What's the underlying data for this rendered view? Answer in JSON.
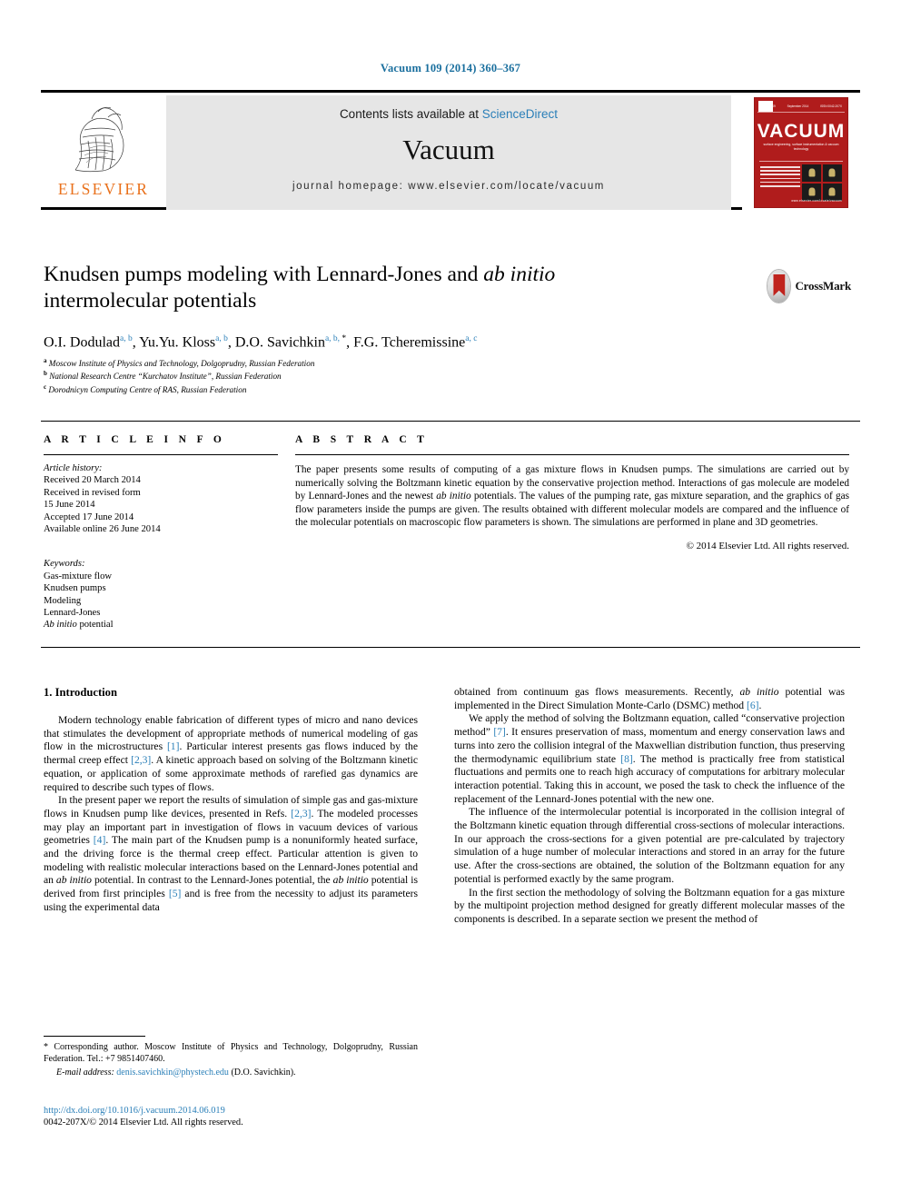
{
  "running_head": "Vacuum 109 (2014) 360–367",
  "masthead": {
    "publisher_name": "ELSEVIER",
    "contents_prefix": "Contents lists available at ",
    "contents_link": "ScienceDirect",
    "journal_title": "Vacuum",
    "homepage": "journal homepage: www.elsevier.com/locate/vacuum",
    "cover": {
      "name": "VACUUM",
      "tick_left": "Volume 109",
      "tick_mid": "September 2014",
      "tick_right": "ISSN 0042-207X",
      "subtitle": "surface engineering, surface instrumentation & vacuum technology",
      "sub2": "Incorporating: Vacuum solutions, surface engineering, thin films,\nsurface instrumentation and plasma applications\nTechnical and Environmental Aspects of Vacuum Science",
      "footer": "www.elsevier.com/locate/vacuum"
    }
  },
  "article": {
    "title_line1": "Knudsen pumps modeling with Lennard-Jones and ",
    "title_italic": "ab initio",
    "title_line2": "intermolecular potentials",
    "crossmark_label": "CrossMark",
    "authors": [
      {
        "name": "O.I. Dodulad",
        "marks": "a, b",
        "sep": ", "
      },
      {
        "name": "Yu.Yu. Kloss",
        "marks": "a, b",
        "sep": ", "
      },
      {
        "name": "D.O. Savichkin",
        "marks": "a, b, ",
        "star": "*",
        "sep": ", "
      },
      {
        "name": "F.G. Tcheremissine",
        "marks": "a, c",
        "sep": ""
      }
    ],
    "affiliations": [
      {
        "mark": "a",
        "text": "Moscow Institute of Physics and Technology, Dolgoprudny, Russian Federation"
      },
      {
        "mark": "b",
        "text": "National Research Centre “Kurchatov Institute”, Russian Federation"
      },
      {
        "mark": "c",
        "text": "Dorodnicyn Computing Centre of RAS, Russian Federation"
      }
    ]
  },
  "info": {
    "heading": "A R T I C L E   I N F O",
    "history_label": "Article history:",
    "history": [
      "Received 20 March 2014",
      "Received in revised form",
      "15 June 2014",
      "Accepted 17 June 2014",
      "Available online 26 June 2014"
    ],
    "keywords_label": "Keywords:",
    "keywords": [
      "Gas-mixture flow",
      "Knudsen pumps",
      "Modeling",
      "Lennard-Jones"
    ],
    "keyword_last_italic": "Ab initio",
    "keyword_last_rest": " potential"
  },
  "abstract": {
    "heading": "A B S T R A C T",
    "part1": "The paper presents some results of computing of a gas mixture flows in Knudsen pumps. The simulations are carried out by numerically solving the Boltzmann kinetic equation by the conservative projection method. Interactions of gas molecule are modeled by Lennard-Jones and the newest ",
    "italic1": "ab initio",
    "part2": " potentials. The values of the pumping rate, gas mixture separation, and the graphics of gas flow parameters inside the pumps are given. The results obtained with different molecular models are compared and the influence of the molecular potentials on macroscopic flow parameters is shown. The simulations are performed in plane and 3D geometries.",
    "copyright": "© 2014 Elsevier Ltd. All rights reserved."
  },
  "body": {
    "section_heading": "1. Introduction",
    "left": {
      "p1_a": "Modern technology enable fabrication of different types of micro and nano devices that stimulates the development of appropriate methods of numerical modeling of gas flow in the microstructures ",
      "p1_ref1": "[1]",
      "p1_b": ". Particular interest presents gas flows induced by the thermal creep effect ",
      "p1_ref2": "[2,3]",
      "p1_c": ". A kinetic approach based on solving of the Boltzmann kinetic equation, or application of some approximate methods of rarefied gas dynamics are required to describe such types of flows.",
      "p2_a": "In the present paper we report the results of simulation of simple gas and gas-mixture flows in Knudsen pump like devices, presented in Refs. ",
      "p2_ref1": "[2,3]",
      "p2_b": ". The modeled processes may play an important part in investigation of flows in vacuum devices of various geometries ",
      "p2_ref2": "[4]",
      "p2_c": ". The main part of the Knudsen pump is a nonuniformly heated surface, and the driving force is the thermal creep effect. Particular attention is given to modeling with realistic molecular interactions based on the Lennard-Jones potential and an ",
      "p2_it1": "ab initio",
      "p2_d": " potential. In contrast to the Lennard-Jones potential, the ",
      "p2_it2": "ab initio",
      "p2_e": " potential is derived from first principles ",
      "p2_ref3": "[5]",
      "p2_f": " and is free from the necessity to adjust its parameters using the experimental data"
    },
    "right": {
      "p1_a": "obtained from continuum gas flows measurements. Recently, ",
      "p1_it1": "ab initio",
      "p1_b": " potential was implemented in the Direct Simulation Monte-Carlo (DSMC) method ",
      "p1_ref1": "[6]",
      "p1_c": ".",
      "p2_a": "We apply the method of solving the Boltzmann equation, called “conservative projection method” ",
      "p2_ref1": "[7]",
      "p2_b": ". It ensures preservation of mass, momentum and energy conservation laws and turns into zero the collision integral of the Maxwellian distribution function, thus preserving the thermodynamic equilibrium state ",
      "p2_ref2": "[8]",
      "p2_c": ". The method is practically free from statistical fluctuations and permits one to reach high accuracy of computations for arbitrary molecular interaction potential. Taking this in account, we posed the task to check the influence of the replacement of the Lennard-Jones potential with the new one.",
      "p3": "The influence of the intermolecular potential is incorporated in the collision integral of the Boltzmann kinetic equation through differential cross-sections of molecular interactions. In our approach the cross-sections for a given potential are pre-calculated by trajectory simulation of a huge number of molecular interactions and stored in an array for the future use. After the cross-sections are obtained, the solution of the Boltzmann equation for any potential is performed exactly by the same program.",
      "p4": "In the first section the methodology of solving the Boltzmann equation for a gas mixture by the multipoint projection method designed for greatly different molecular masses of the components is described. In a separate section we present the method of"
    }
  },
  "footnotes": {
    "star": "*",
    "corresponding": " Corresponding author. Moscow Institute of Physics and Technology, Dolgoprudny, Russian Federation. Tel.: +7 9851407460.",
    "email_label": "E-mail address:",
    "email": "denis.savichkin@phystech.edu",
    "email_suffix": " (D.O. Savichkin)."
  },
  "doi_block": {
    "doi_url": "http://dx.doi.org/10.1016/j.vacuum.2014.06.019",
    "issn_line": "0042-207X/© 2014 Elsevier Ltd. All rights reserved."
  }
}
